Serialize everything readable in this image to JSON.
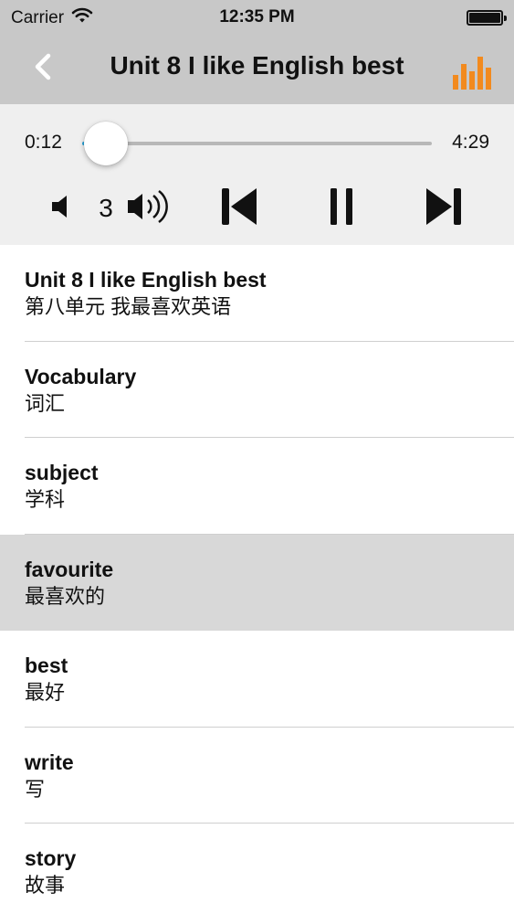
{
  "status_bar": {
    "carrier": "Carrier",
    "time": "12:35 PM",
    "icons": [
      "wifi-icon",
      "battery-icon"
    ]
  },
  "nav": {
    "title": "Unit 8 I like English best",
    "back_icon": "chevron-left-icon",
    "right_icon": "equalizer-icon",
    "accent_color": "#f28a1e"
  },
  "player": {
    "current_time": "0:12",
    "total_time": "4:29",
    "progress": 0.045,
    "volume": "3",
    "progress_color": "#2aa5dc",
    "icons": [
      "volume-down-icon",
      "volume-up-icon",
      "skip-previous-icon",
      "pause-icon",
      "skip-next-icon"
    ]
  },
  "list": {
    "items": [
      {
        "en": "Unit 8 I like English best",
        "zh": "第八单元 我最喜欢英语",
        "selected": false
      },
      {
        "en": "Vocabulary",
        "zh": "词汇",
        "selected": false
      },
      {
        "en": "subject",
        "zh": "学科",
        "selected": false
      },
      {
        "en": "favourite",
        "zh": "最喜欢的",
        "selected": true
      },
      {
        "en": "best",
        "zh": "最好",
        "selected": false
      },
      {
        "en": "write",
        "zh": "写",
        "selected": false
      },
      {
        "en": "story",
        "zh": "故事",
        "selected": false
      }
    ],
    "selected_color": "#d8d8d8"
  }
}
